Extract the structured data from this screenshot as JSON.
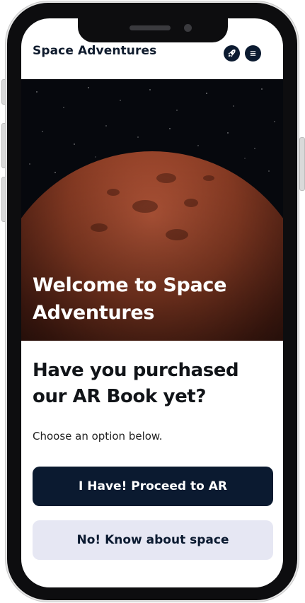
{
  "app": {
    "title": "Space Adventures"
  },
  "header": {
    "icons": [
      "rocket-icon",
      "menu-icon"
    ]
  },
  "hero": {
    "title": "Welcome to Space Adventures"
  },
  "main": {
    "question": "Have you purchased our AR Book yet?",
    "instruction": "Choose an option below.",
    "primary_button": "I Have! Proceed to AR",
    "secondary_button": "No! Know about space"
  },
  "colors": {
    "primary": "#0b1a30",
    "secondary_bg": "#e6e7f3",
    "planet": "#7a3a22"
  }
}
